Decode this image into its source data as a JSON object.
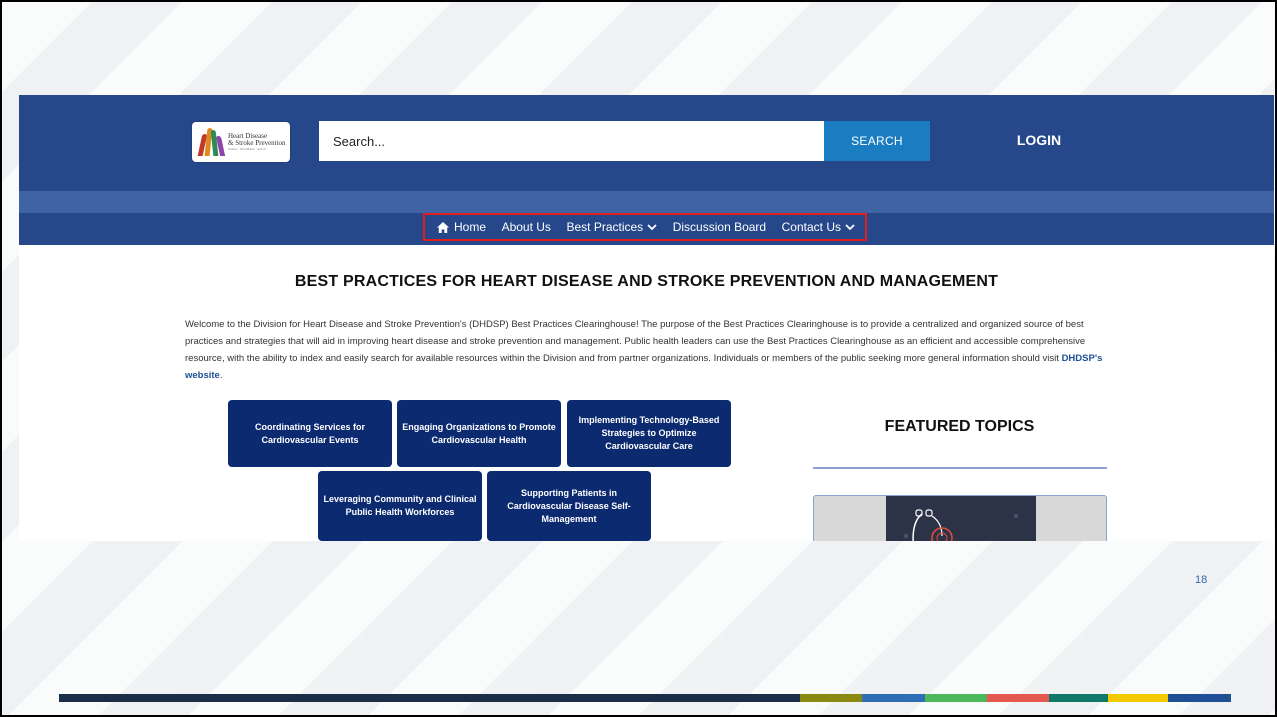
{
  "header": {
    "logo": {
      "line1": "Heart Disease",
      "line2": "& Stroke Prevention",
      "tagline": "Science · Surveillance · Action"
    },
    "search": {
      "placeholder": "Search...",
      "button_label": "SEARCH"
    },
    "login_label": "LOGIN"
  },
  "nav": {
    "items": [
      {
        "label": "Home",
        "icon": "home-icon"
      },
      {
        "label": "About Us"
      },
      {
        "label": "Best Practices",
        "icon": "chevron-down-icon"
      },
      {
        "label": "Discussion Board"
      },
      {
        "label": "Contact Us",
        "icon": "chevron-down-icon"
      }
    ]
  },
  "main": {
    "heading": "BEST PRACTICES FOR HEART DISEASE AND STROKE PREVENTION AND MANAGEMENT",
    "intro": "Welcome to the Division for Heart Disease and Stroke Prevention's (DHDSP) Best Practices Clearinghouse! The purpose of the Best Practices Clearinghouse is to provide a centralized and organized source of best practices and strategies that will aid in improving heart disease and stroke prevention and management. Public health leaders can use the Best Practices Clearinghouse as an efficient and accessible comprehensive resource, with the ability to index and easily search for available resources within the Division and from partner organizations. Individuals or members of the public seeking more general information should visit",
    "intro_link": "DHDSP's website",
    "intro_end": ".",
    "topics": [
      "Coordinating Services for Cardiovascular Events",
      "Engaging Organizations to Promote Cardiovascular Health",
      "Implementing Technology-Based Strategies to Optimize Cardiovascular Care",
      "Leveraging Community and Clinical Public Health Workforces",
      "Supporting Patients in Cardiovascular Disease Self-Management"
    ]
  },
  "featured": {
    "title": "FEATURED TOPICS"
  },
  "slide": {
    "page_number": "18"
  },
  "colors": {
    "header_blue": "#26488a",
    "search_button": "#1a7cc1",
    "topic_button": "#0c2a70",
    "highlight_box": "#e01e1e",
    "bottom_bar": [
      "#1c2d48",
      "#8a8a12",
      "#2f6db5",
      "#4bb85c",
      "#e5584f",
      "#107a6a",
      "#f3c900",
      "#1f4f95"
    ]
  }
}
